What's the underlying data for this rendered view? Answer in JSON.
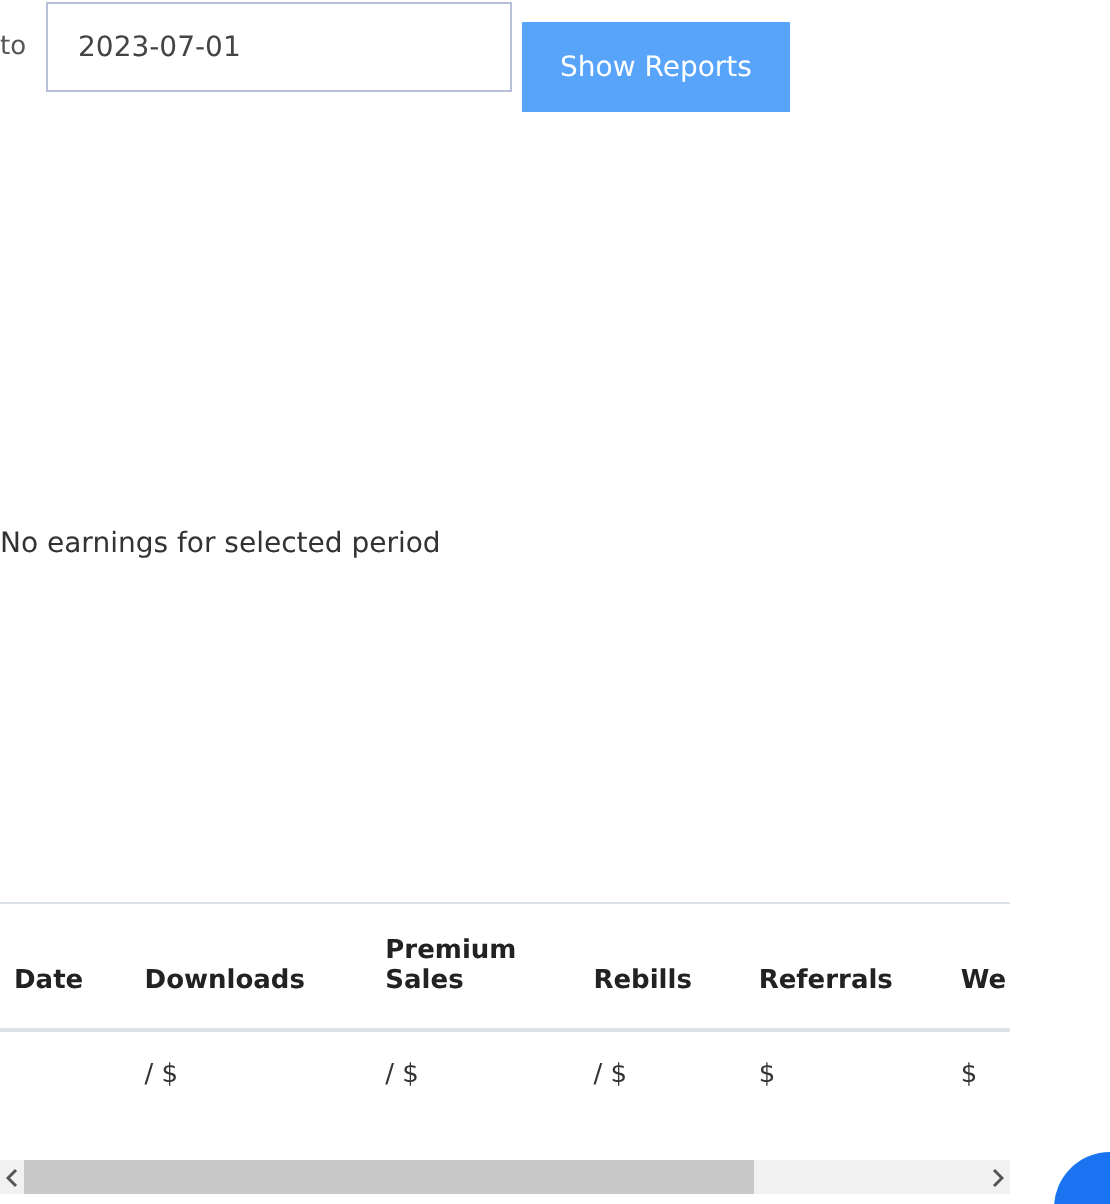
{
  "filter": {
    "to_label": "to",
    "to_value": "2023-07-01",
    "button": "Show Reports"
  },
  "message": "No earnings for selected period",
  "table": {
    "columns": [
      "Date",
      "Downloads",
      "Premium Sales",
      "Rebills",
      "Referrals",
      "We"
    ],
    "rows": [
      {
        "cells": [
          "",
          "/ $",
          "/ $",
          "/ $",
          "$",
          "$"
        ]
      }
    ]
  }
}
